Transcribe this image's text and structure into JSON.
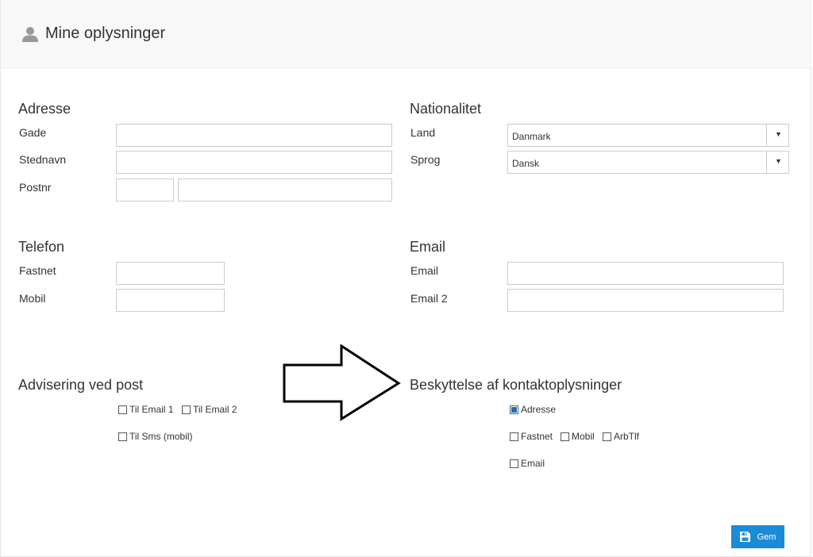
{
  "header": {
    "title": "Mine oplysninger",
    "icon": "user-icon"
  },
  "adresse": {
    "title": "Adresse",
    "gade_label": "Gade",
    "gade_value": "",
    "stednavn_label": "Stednavn",
    "stednavn_value": "",
    "postnr_label": "Postnr",
    "postnr_value": "",
    "by_value": ""
  },
  "nationalitet": {
    "title": "Nationalitet",
    "land_label": "Land",
    "land_value": "Danmark",
    "sprog_label": "Sprog",
    "sprog_value": "Dansk"
  },
  "telefon": {
    "title": "Telefon",
    "fastnet_label": "Fastnet",
    "fastnet_value": "",
    "mobil_label": "Mobil",
    "mobil_value": ""
  },
  "email": {
    "title": "Email",
    "email_label": "Email",
    "email_value": "",
    "email2_label": "Email 2",
    "email2_value": ""
  },
  "advisering": {
    "title": "Advisering ved post",
    "options": [
      {
        "label": "Til Email 1",
        "checked": false
      },
      {
        "label": "Til Email 2",
        "checked": false
      },
      {
        "label": "Til Sms (mobil)",
        "checked": false
      }
    ]
  },
  "beskyttelse": {
    "title": "Beskyttelse af kontaktoplysninger",
    "options": [
      {
        "label": "Adresse",
        "checked": true
      },
      {
        "label": "Fastnet",
        "checked": false
      },
      {
        "label": "Mobil",
        "checked": false
      },
      {
        "label": "ArbTlf",
        "checked": false
      },
      {
        "label": "Email",
        "checked": false
      }
    ]
  },
  "save_button": {
    "label": "Gem",
    "color": "#1b8bd6"
  }
}
